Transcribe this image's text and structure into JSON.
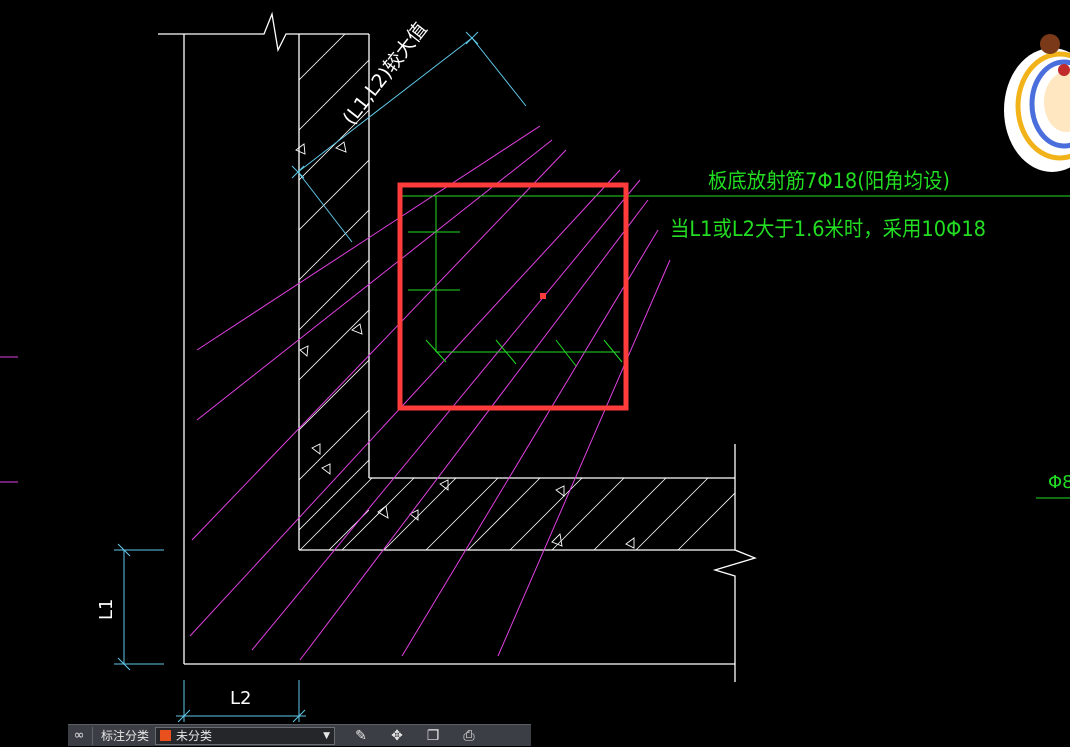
{
  "drawing": {
    "dim_note": "(L1,L2)较大值",
    "annotation_line1": "板底放射筋7Φ18(阳角均设)",
    "annotation_line2": "当L1或L2大于1.6米时，采用10Φ18",
    "dim_label_l1": "L1",
    "dim_label_l2": "L2",
    "edge_cut_label": "Φ8",
    "colors": {
      "wall": "#ffffff",
      "rebar": "#e040e0",
      "dimension": "#5fc8e8",
      "annotation": "#22dd22",
      "highlight": "#ff3b3b"
    }
  },
  "toolbar": {
    "layers_icon": "layers-icon",
    "category_label": "标注分类",
    "category_value": "未分类",
    "category_color": "#e8501e",
    "tools": [
      {
        "name": "edit-pen-icon",
        "glyph": "✎"
      },
      {
        "name": "move-icon",
        "glyph": "✥"
      },
      {
        "name": "copy-icon",
        "glyph": "❐"
      },
      {
        "name": "print-icon",
        "glyph": "⎙"
      }
    ]
  }
}
